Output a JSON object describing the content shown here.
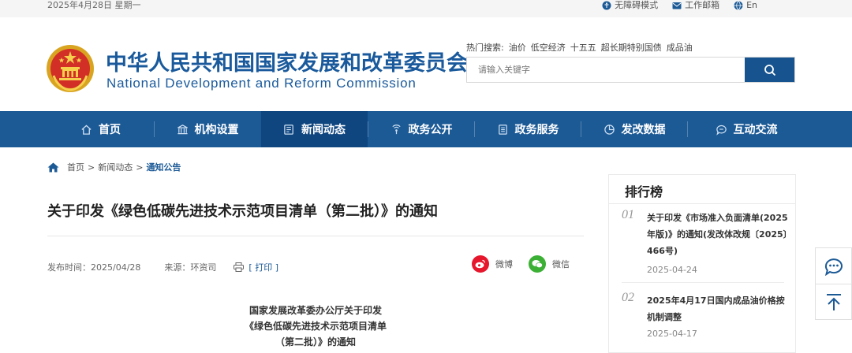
{
  "topbar": {
    "date": "2025年4月28日 星期一",
    "accessibility": "无障碍模式",
    "mailbox": "工作邮箱",
    "lang": "En"
  },
  "header": {
    "site_name_cn": "中华人民共和国国家发展和改革委员会",
    "site_name_en": "National Development and Reform Commission",
    "hot_label": "热门搜索:",
    "hot_items": [
      "油价",
      "低空经济",
      "十五五",
      "超长期特别国债",
      "成品油"
    ],
    "search_placeholder": "请输入关键字"
  },
  "nav": {
    "items": [
      {
        "label": "首页",
        "icon": "home-icon"
      },
      {
        "label": "机构设置",
        "icon": "building-icon"
      },
      {
        "label": "新闻动态",
        "icon": "news-icon"
      },
      {
        "label": "政务公开",
        "icon": "broadcast-icon"
      },
      {
        "label": "政务服务",
        "icon": "document-icon"
      },
      {
        "label": "发改数据",
        "icon": "pie-chart-icon"
      },
      {
        "label": "互动交流",
        "icon": "chat-icon"
      }
    ],
    "active_index": 2,
    "bar_color": "#1c5a96",
    "active_color": "#0f4680"
  },
  "breadcrumb": {
    "home": "首页",
    "sep1": ">",
    "section": "新闻动态",
    "sep2": ">",
    "current": "通知公告"
  },
  "article": {
    "title": "关于印发《绿色低碳先进技术示范项目清单（第二批）》的通知",
    "publish_label": "发布时间：2025/04/28",
    "source_label": "来源：环资司",
    "print_label": "[ 打印 ]",
    "share_weibo": "微博",
    "share_wechat": "微信",
    "body_title_lines": [
      "国家发展改革委办公厅关于印发",
      "《绿色低碳先进技术示范项目清单",
      "（第二批）》的通知"
    ]
  },
  "ranking": {
    "title": "排行榜",
    "items": [
      {
        "num": "01",
        "text": "关于印发《市场准入负面清单(2025年版)》的通知(发改体改规〔2025〕466号)",
        "date": "2025-04-24"
      },
      {
        "num": "02",
        "text": "2025年4月17日国内成品油价格按机制调整",
        "date": "2025-04-17"
      }
    ]
  }
}
